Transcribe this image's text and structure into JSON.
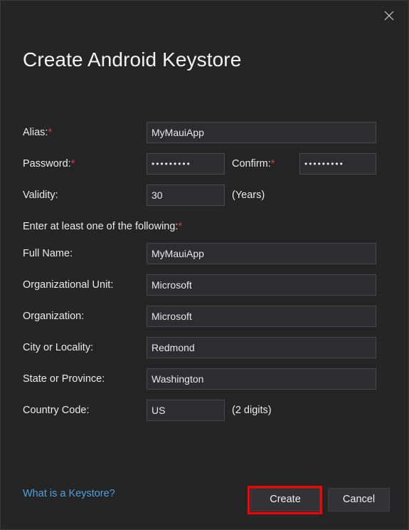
{
  "window": {
    "title": "Create Android Keystore",
    "close_icon": "close-icon",
    "background_color": "#252526",
    "accent_required_color": "#e03a3a",
    "link_color": "#4ea1dd",
    "highlight_color": "#fe0000"
  },
  "form": {
    "alias": {
      "label": "Alias:",
      "required_marker": "*",
      "value": "MyMauiApp",
      "placeholder": ""
    },
    "password": {
      "label": "Password:",
      "required_marker": "*",
      "value": "•••••••••",
      "placeholder": ""
    },
    "confirm": {
      "label": "Confirm:",
      "required_marker": "*",
      "value": "•••••••••",
      "placeholder": ""
    },
    "validity": {
      "label": "Validity:",
      "value": "30",
      "suffix": "(Years)",
      "placeholder": ""
    },
    "section_note": {
      "text": "Enter at least one of the following:",
      "required_marker": "*"
    },
    "full_name": {
      "label": "Full Name:",
      "value": "MyMauiApp",
      "placeholder": ""
    },
    "organizational_unit": {
      "label": "Organizational Unit:",
      "value": "Microsoft",
      "placeholder": ""
    },
    "organization": {
      "label": "Organization:",
      "value": "Microsoft",
      "placeholder": ""
    },
    "city": {
      "label": "City or Locality:",
      "value": "Redmond",
      "placeholder": ""
    },
    "state": {
      "label": "State or Province:",
      "value": "Washington",
      "placeholder": ""
    },
    "country_code": {
      "label": "Country Code:",
      "value": "US",
      "suffix": "(2 digits)",
      "placeholder": ""
    }
  },
  "footer": {
    "help_link": "What is a Keystore?",
    "create_label": "Create",
    "cancel_label": "Cancel"
  }
}
